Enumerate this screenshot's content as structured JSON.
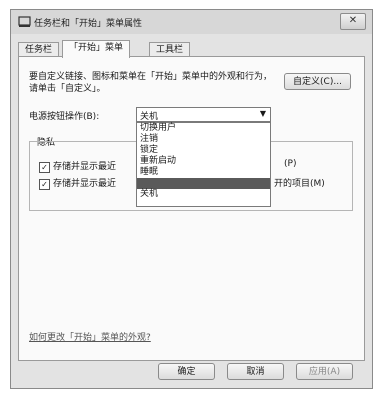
{
  "window": {
    "title": "任务栏和「开始」菜单属性",
    "close_symbol": "✕",
    "icon_name": "taskbar-properties-icon",
    "icon_color": "#333333"
  },
  "tabs": [
    {
      "label": "任务栏",
      "active": false
    },
    {
      "label": "「开始」菜单",
      "active": true
    },
    {
      "label": "工具栏",
      "active": false
    }
  ],
  "start_menu": {
    "description": "要自定义链接、图标和菜单在「开始」菜单中的外观和行为，请单击「自定义」。",
    "customize_label": "自定义(C)...",
    "power_label": "电源按钮操作(B):",
    "power_value": "关机",
    "power_options": [
      {
        "label": "切换用户",
        "selected": false
      },
      {
        "label": "注销",
        "selected": false
      },
      {
        "label": "锁定",
        "selected": false
      },
      {
        "label": "重新启动",
        "selected": false
      },
      {
        "label": "睡眠",
        "selected": false
      },
      {
        "label": "",
        "selected": true
      },
      {
        "label": "关机",
        "selected": false
      }
    ],
    "privacy_title": "隐私",
    "check1_label": "存储并显示最近",
    "check1_tail": "(P)",
    "check2_label": "存储并显示最近",
    "check2_tail": "开的项目(M)",
    "help_link": "如何更改「开始」菜单的外观?"
  },
  "footer": {
    "ok_label": "确定",
    "cancel_label": "取消",
    "apply_label": "应用(A)"
  }
}
